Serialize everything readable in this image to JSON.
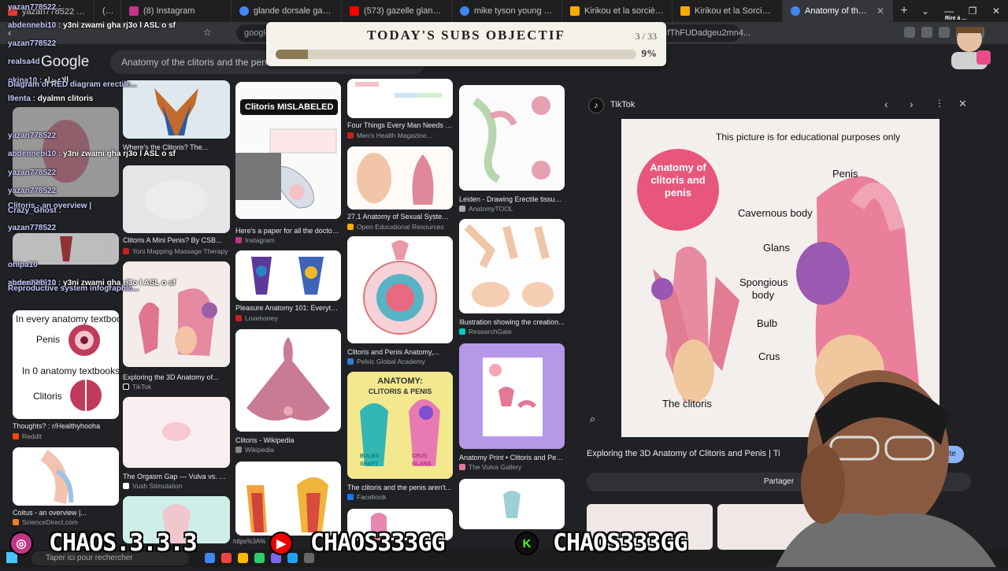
{
  "tabs": [
    {
      "label": "yazan778522 : التربية الاسلامية",
      "color": "#e53935"
    },
    {
      "label": "(573)",
      "color": "#f44336"
    },
    {
      "label": "(8) Instagram",
      "color": "#c13584"
    },
    {
      "label": "glande dorsale gazelle - Reche",
      "color": "#4285f4"
    },
    {
      "label": "(573) gazelle glandes dorssale",
      "color": "#ff0000"
    },
    {
      "label": "mike tyson young - Recherche",
      "color": "#4285f4"
    },
    {
      "label": "Kirikou et la sorcière - Film 19",
      "color": "#f9ab00"
    },
    {
      "label": "Kirikou et la Sorcière (1998)",
      "color": "#f9ab00"
    },
    {
      "label": "Anatomy of the clitoris and pe",
      "color": "#4285f4",
      "active": true
    }
  ],
  "newtab": "+",
  "window_controls": [
    "⌄",
    "—",
    "❐",
    "✕"
  ],
  "omnibox": {
    "url": "google.co",
    "tail": "BfThFUDadgeu2mn4..."
  },
  "google": {
    "logo": "Google",
    "query": "Anatomy of the clitoris and the penis"
  },
  "objective": {
    "title": "TODAY'S SUBS OBJECTIF",
    "count": "3 / 33",
    "percent": "9%",
    "progress": 0.09
  },
  "results": [
    {
      "caption": "Where's the Clitoris? The...",
      "source": ""
    },
    {
      "caption": "Clitoris A Mini Penis? By CSB...",
      "source": "Yoni Mapping Massage Therapy"
    },
    {
      "caption": "Exploring the 3D Anatomy of...",
      "source": "TikTok"
    },
    {
      "caption": "The Orgasm Gap — Vulva vs. Pen...",
      "source": "Vush Stimulation"
    },
    {
      "caption": "Clitoris MISLABELED",
      "source": ""
    },
    {
      "caption": "Here's a paper for all the doctors...",
      "source": "Instagram"
    },
    {
      "caption": "Pleasure Anatomy 101: Everythin...",
      "source": "Lovehoney"
    },
    {
      "caption": "Clitoris - Wikipedia",
      "source": "Wikipedia"
    },
    {
      "caption": "Four Things Every Man Needs To...",
      "source": "Men's Health Magazine..."
    },
    {
      "caption": "27.1 Anatomy of Sexual Systems ...",
      "source": "Open Educational Resources"
    },
    {
      "caption": "Clitoris and Penis Anatomy,...",
      "source": "Pelvic Global Academy"
    },
    {
      "caption": "The clitoris and the penis aren't...",
      "source": "Facebook"
    },
    {
      "caption": "Leiden - Drawing Erectile tissue ...",
      "source": "AnatomyTOOL"
    },
    {
      "caption": "Illustration showing the creation...",
      "source": "ResearchGate"
    },
    {
      "caption": "Anatomy Print • Clitoris and Peni...",
      "source": "The Vulva Gallery"
    },
    {
      "caption": "Thoughts? : r/Healthyhooha",
      "source": "Reddit"
    },
    {
      "caption": "Coitus - an overview |...",
      "source": "ScienceDirect.com"
    }
  ],
  "textbook": {
    "line1": "In every anatomy textbook:",
    "label1": "Penis",
    "line2": "In 0 anatomy textbooks:",
    "label2": "Clitoris"
  },
  "anatomy_card": {
    "title": "ANATOMY:",
    "subtitle": "CLITORIS & PENIS",
    "l1": "BULBS",
    "l2": "SHAFT",
    "l3": "CRUS",
    "l4": "GLANS"
  },
  "panel": {
    "source": "TikTok",
    "notice": "This picture is for educational purposes only",
    "badge": "Anatomy of clitoris and penis",
    "labels": {
      "penis": "Penis",
      "cavernous": "Cavernous body",
      "glans": "Glans",
      "spongious": "Spongious body",
      "bulb": "Bulb",
      "crus": "Crus",
      "clitoris": "The clitoris"
    },
    "caption": "Exploring the 3D Anatomy of Clitoris and Penis | Ti",
    "visit": "Accéder au site",
    "share": "Partager"
  },
  "chat": [
    {
      "user": "yazan778522 :",
      "text": ""
    },
    {
      "user": "abdennebi10 :",
      "text": "y3ni zwami gha rj3o l ASL o sf"
    },
    {
      "user": "yazan778522",
      "text": ""
    },
    {
      "user": "realsa4d",
      "text": ""
    },
    {
      "user": "okina10 :",
      "text": "الاعضاء"
    },
    {
      "user": "Diagram of RED diagram erectile...",
      "text": ""
    },
    {
      "user": "l9enta :",
      "text": "dyalmn clitoris"
    },
    {
      "user": "yazan778522",
      "text": ""
    },
    {
      "user": "abdennebi10 :",
      "text": "y3ni zwami gha rj3o l ASL o sf"
    },
    {
      "user": "yazan778522",
      "text": ""
    },
    {
      "user": "yazan778522",
      "text": ""
    },
    {
      "user": "Clitoris - an overview |",
      "text": ""
    },
    {
      "user": "Crazy_Ghost :",
      "text": ""
    },
    {
      "user": "yazan778522",
      "text": ""
    },
    {
      "user": "ohipa10",
      "text": ""
    },
    {
      "user": "yazan778522",
      "text": ""
    },
    {
      "user": "abdennebi10 :",
      "text": "y3ni zwami gha rj3o l ASL o sf"
    },
    {
      "user": "Reproductive system infographic...",
      "text": ""
    }
  ],
  "banner": {
    "ig": "CHAOS.3.3.3",
    "yt": "CHAOS333GG",
    "kick": "CHAOS333GG"
  },
  "taskbar": {
    "search": "Taper ici pour rechercher"
  },
  "overlay_tiny": "Rire à ...",
  "url_fragment": "https%3A%",
  "icons": {
    "ig": "instagram-icon",
    "yt": "youtube-icon",
    "kick": "kick-icon"
  }
}
